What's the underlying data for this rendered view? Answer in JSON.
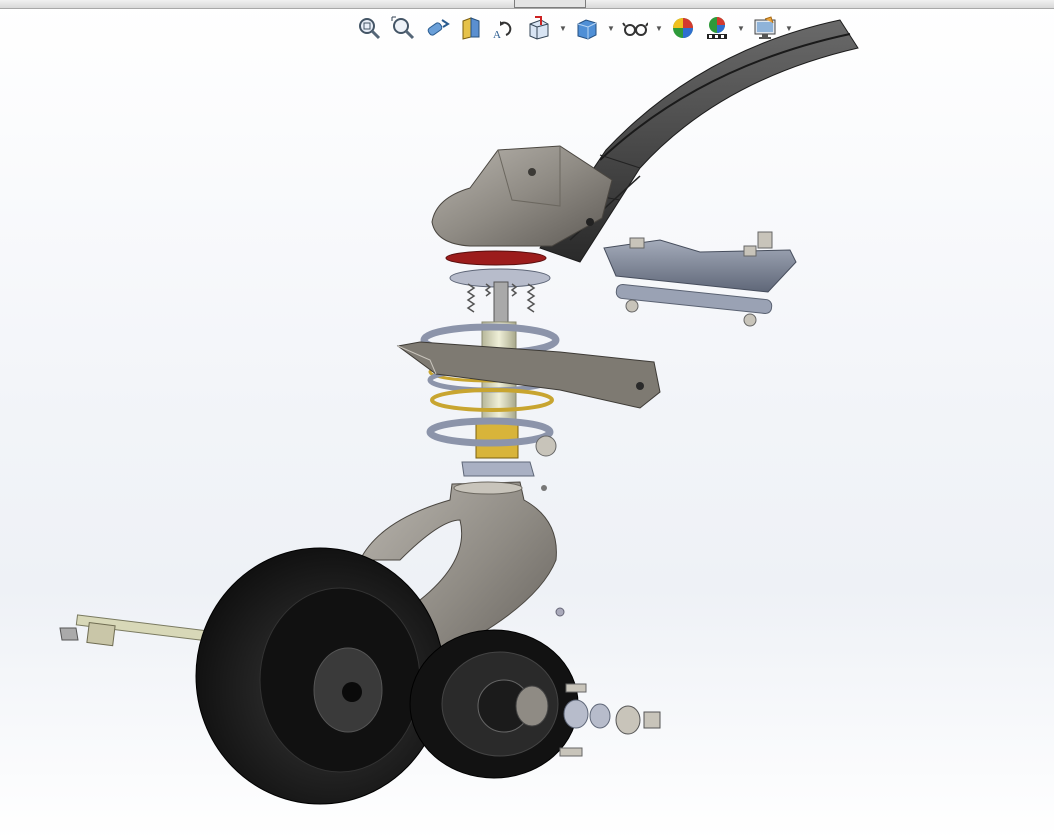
{
  "window": {
    "title": ""
  },
  "toolbar": {
    "buttons": [
      {
        "name": "zoom-to-fit-icon"
      },
      {
        "name": "zoom-to-area-icon"
      },
      {
        "name": "previous-view-icon"
      },
      {
        "name": "section-view-icon"
      },
      {
        "name": "dynamic-annotation-icon"
      },
      {
        "name": "view-orientation-icon",
        "dropdown": true
      },
      {
        "name": "display-style-icon",
        "dropdown": true
      },
      {
        "name": "hide-show-items-icon",
        "dropdown": true
      },
      {
        "name": "edit-appearance-icon"
      },
      {
        "name": "apply-scene-icon",
        "dropdown": true
      },
      {
        "name": "view-settings-icon",
        "dropdown": true
      }
    ]
  },
  "model": {
    "kind": "exploded assembly view",
    "colors": {
      "casting": "#8f8b84",
      "spring_leaf": "#3a3a3a",
      "bracket": "#7d8597",
      "coil_gold": "#c8a530",
      "tire": "#1b1b1b",
      "washer_red": "#9c1c1c",
      "shaft": "#d8d8b8"
    }
  }
}
